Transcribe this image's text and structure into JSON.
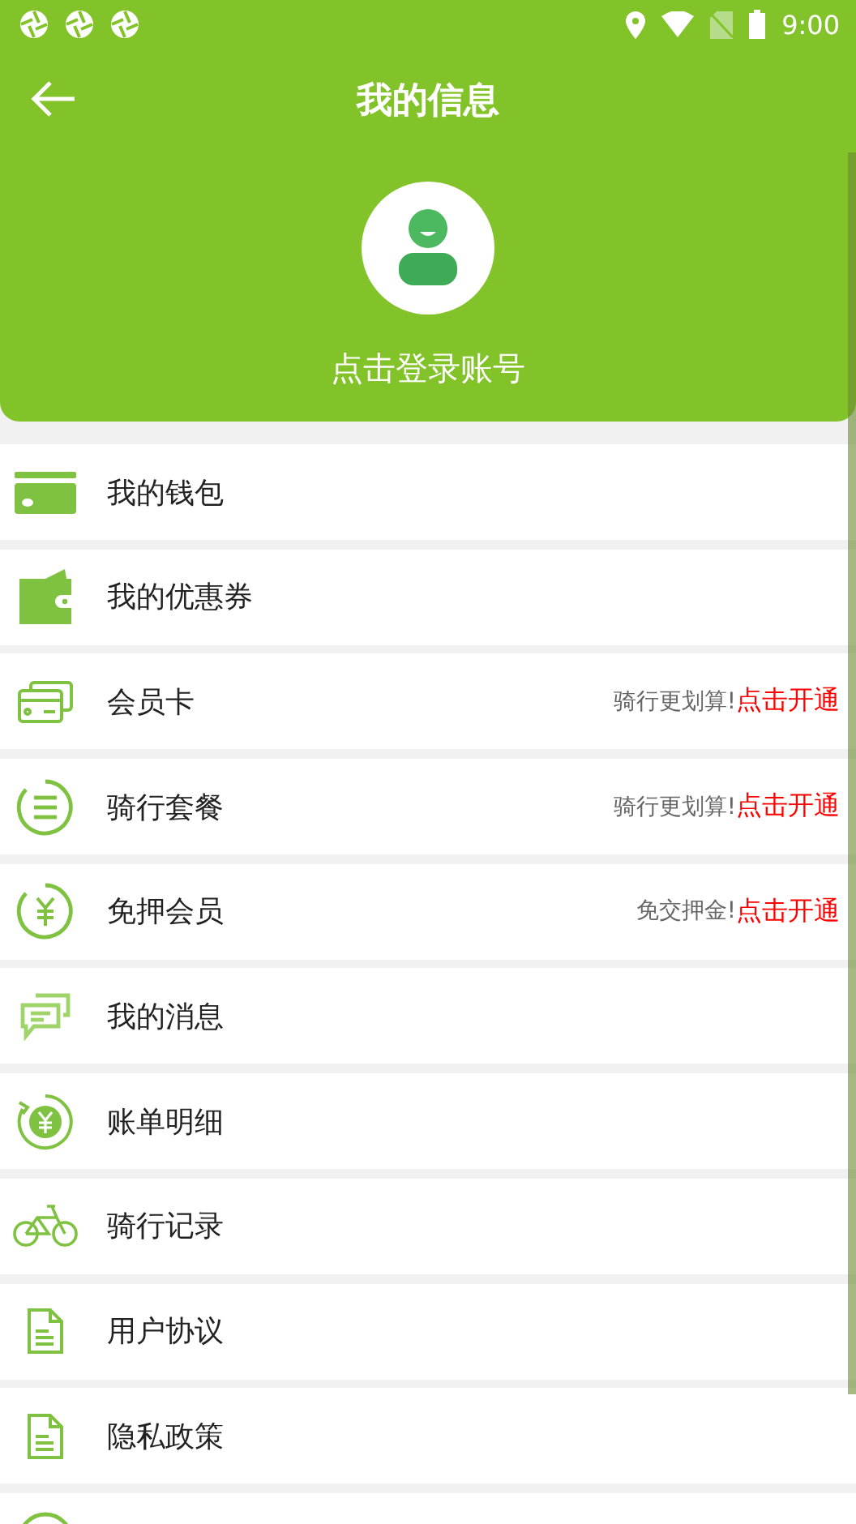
{
  "status_bar": {
    "time": "9:00"
  },
  "app_bar": {
    "title": "我的信息"
  },
  "profile": {
    "login_text": "点击登录账号"
  },
  "menu": [
    {
      "kind": "card",
      "label": "我的钱包"
    },
    {
      "kind": "wallet",
      "label": "我的优惠券"
    },
    {
      "kind": "vip",
      "label": "会员卡",
      "hint": "骑行更划算!",
      "action": "点击开通"
    },
    {
      "kind": "list",
      "label": "骑行套餐",
      "hint": "骑行更划算!",
      "action": "点击开通"
    },
    {
      "kind": "yuan",
      "label": "免押会员",
      "hint": "免交押金!",
      "action": "点击开通"
    },
    {
      "kind": "chat",
      "label": "我的消息"
    },
    {
      "kind": "bill",
      "label": "账单明细"
    },
    {
      "kind": "bike",
      "label": "骑行记录"
    },
    {
      "kind": "doc",
      "label": "用户协议"
    },
    {
      "kind": "doc",
      "label": "隐私政策"
    },
    {
      "kind": "circle"
    }
  ]
}
